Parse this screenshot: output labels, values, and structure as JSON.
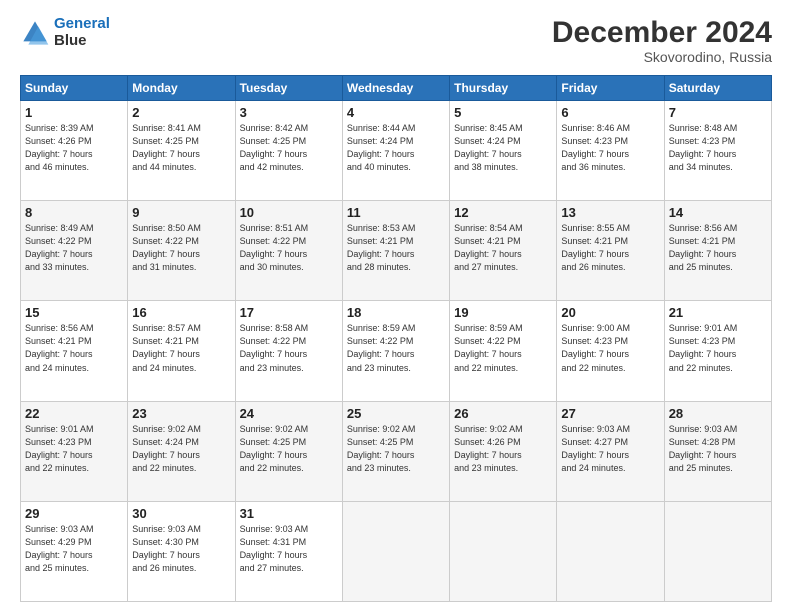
{
  "header": {
    "logo_line1": "General",
    "logo_line2": "Blue",
    "title": "December 2024",
    "subtitle": "Skovorodino, Russia"
  },
  "columns": [
    "Sunday",
    "Monday",
    "Tuesday",
    "Wednesday",
    "Thursday",
    "Friday",
    "Saturday"
  ],
  "weeks": [
    [
      {
        "day": "1",
        "text": "Sunrise: 8:39 AM\nSunset: 4:26 PM\nDaylight: 7 hours\nand 46 minutes."
      },
      {
        "day": "2",
        "text": "Sunrise: 8:41 AM\nSunset: 4:25 PM\nDaylight: 7 hours\nand 44 minutes."
      },
      {
        "day": "3",
        "text": "Sunrise: 8:42 AM\nSunset: 4:25 PM\nDaylight: 7 hours\nand 42 minutes."
      },
      {
        "day": "4",
        "text": "Sunrise: 8:44 AM\nSunset: 4:24 PM\nDaylight: 7 hours\nand 40 minutes."
      },
      {
        "day": "5",
        "text": "Sunrise: 8:45 AM\nSunset: 4:24 PM\nDaylight: 7 hours\nand 38 minutes."
      },
      {
        "day": "6",
        "text": "Sunrise: 8:46 AM\nSunset: 4:23 PM\nDaylight: 7 hours\nand 36 minutes."
      },
      {
        "day": "7",
        "text": "Sunrise: 8:48 AM\nSunset: 4:23 PM\nDaylight: 7 hours\nand 34 minutes."
      }
    ],
    [
      {
        "day": "8",
        "text": "Sunrise: 8:49 AM\nSunset: 4:22 PM\nDaylight: 7 hours\nand 33 minutes."
      },
      {
        "day": "9",
        "text": "Sunrise: 8:50 AM\nSunset: 4:22 PM\nDaylight: 7 hours\nand 31 minutes."
      },
      {
        "day": "10",
        "text": "Sunrise: 8:51 AM\nSunset: 4:22 PM\nDaylight: 7 hours\nand 30 minutes."
      },
      {
        "day": "11",
        "text": "Sunrise: 8:53 AM\nSunset: 4:21 PM\nDaylight: 7 hours\nand 28 minutes."
      },
      {
        "day": "12",
        "text": "Sunrise: 8:54 AM\nSunset: 4:21 PM\nDaylight: 7 hours\nand 27 minutes."
      },
      {
        "day": "13",
        "text": "Sunrise: 8:55 AM\nSunset: 4:21 PM\nDaylight: 7 hours\nand 26 minutes."
      },
      {
        "day": "14",
        "text": "Sunrise: 8:56 AM\nSunset: 4:21 PM\nDaylight: 7 hours\nand 25 minutes."
      }
    ],
    [
      {
        "day": "15",
        "text": "Sunrise: 8:56 AM\nSunset: 4:21 PM\nDaylight: 7 hours\nand 24 minutes."
      },
      {
        "day": "16",
        "text": "Sunrise: 8:57 AM\nSunset: 4:21 PM\nDaylight: 7 hours\nand 24 minutes."
      },
      {
        "day": "17",
        "text": "Sunrise: 8:58 AM\nSunset: 4:22 PM\nDaylight: 7 hours\nand 23 minutes."
      },
      {
        "day": "18",
        "text": "Sunrise: 8:59 AM\nSunset: 4:22 PM\nDaylight: 7 hours\nand 23 minutes."
      },
      {
        "day": "19",
        "text": "Sunrise: 8:59 AM\nSunset: 4:22 PM\nDaylight: 7 hours\nand 22 minutes."
      },
      {
        "day": "20",
        "text": "Sunrise: 9:00 AM\nSunset: 4:23 PM\nDaylight: 7 hours\nand 22 minutes."
      },
      {
        "day": "21",
        "text": "Sunrise: 9:01 AM\nSunset: 4:23 PM\nDaylight: 7 hours\nand 22 minutes."
      }
    ],
    [
      {
        "day": "22",
        "text": "Sunrise: 9:01 AM\nSunset: 4:23 PM\nDaylight: 7 hours\nand 22 minutes."
      },
      {
        "day": "23",
        "text": "Sunrise: 9:02 AM\nSunset: 4:24 PM\nDaylight: 7 hours\nand 22 minutes."
      },
      {
        "day": "24",
        "text": "Sunrise: 9:02 AM\nSunset: 4:25 PM\nDaylight: 7 hours\nand 22 minutes."
      },
      {
        "day": "25",
        "text": "Sunrise: 9:02 AM\nSunset: 4:25 PM\nDaylight: 7 hours\nand 23 minutes."
      },
      {
        "day": "26",
        "text": "Sunrise: 9:02 AM\nSunset: 4:26 PM\nDaylight: 7 hours\nand 23 minutes."
      },
      {
        "day": "27",
        "text": "Sunrise: 9:03 AM\nSunset: 4:27 PM\nDaylight: 7 hours\nand 24 minutes."
      },
      {
        "day": "28",
        "text": "Sunrise: 9:03 AM\nSunset: 4:28 PM\nDaylight: 7 hours\nand 25 minutes."
      }
    ],
    [
      {
        "day": "29",
        "text": "Sunrise: 9:03 AM\nSunset: 4:29 PM\nDaylight: 7 hours\nand 25 minutes."
      },
      {
        "day": "30",
        "text": "Sunrise: 9:03 AM\nSunset: 4:30 PM\nDaylight: 7 hours\nand 26 minutes."
      },
      {
        "day": "31",
        "text": "Sunrise: 9:03 AM\nSunset: 4:31 PM\nDaylight: 7 hours\nand 27 minutes."
      },
      {
        "day": "",
        "text": ""
      },
      {
        "day": "",
        "text": ""
      },
      {
        "day": "",
        "text": ""
      },
      {
        "day": "",
        "text": ""
      }
    ]
  ]
}
